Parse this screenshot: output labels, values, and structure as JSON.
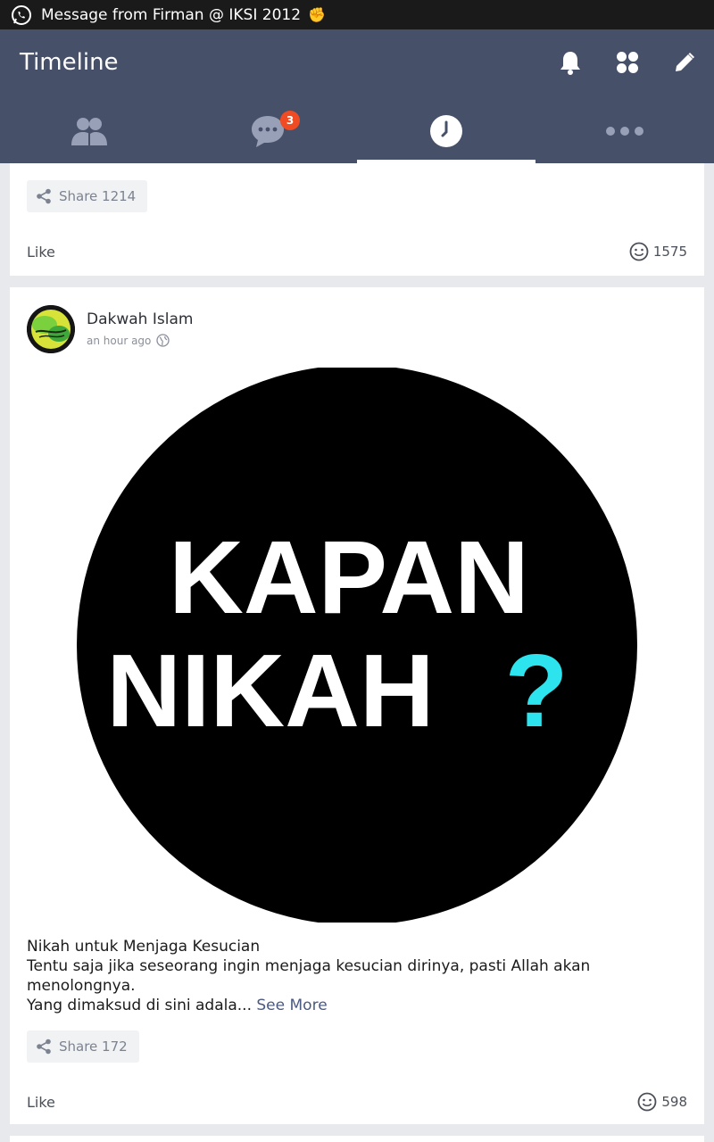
{
  "status_bar": {
    "notification_text": "Message from Firman @ IKSI 2012",
    "notification_app_icon": "whatsapp-icon",
    "notification_emoji": "fist-bump-emoji"
  },
  "header": {
    "title": "Timeline",
    "actions": [
      "bell-icon",
      "apps-grid-icon",
      "pencil-icon"
    ]
  },
  "tabs": [
    {
      "icon": "friends-icon",
      "active": false
    },
    {
      "icon": "chat-icon",
      "badge": "3",
      "active": false
    },
    {
      "icon": "clock-icon",
      "active": true
    },
    {
      "icon": "more-icon",
      "active": false
    }
  ],
  "posts": [
    {
      "share_label": "Share 1214",
      "like_label": "Like",
      "like_count": "1575"
    },
    {
      "author": "Dakwah Islam",
      "time": "an hour ago",
      "image_text": {
        "line1": "KAPAN",
        "line2": "NIKAH",
        "mark": "?"
      },
      "body": [
        "Nikah untuk Menjaga Kesucian",
        "Tentu saja jika seseorang ingin menjaga kesucian dirinya, pasti Allah akan menolongnya.",
        "Yang dimaksud di sini adala..."
      ],
      "see_more": "See More",
      "share_label": "Share 172",
      "like_label": "Like",
      "like_count": "598"
    }
  ],
  "colors": {
    "header_bg": "#475069",
    "badge": "#f04b23",
    "question_mark": "#2de4ee",
    "page_bg": "#e8e9ec"
  }
}
